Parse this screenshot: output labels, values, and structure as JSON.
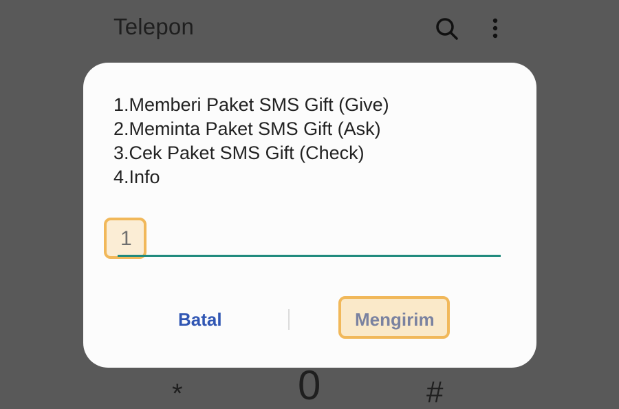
{
  "app": {
    "title": "Telepon",
    "icons": {
      "search": "search-icon",
      "more": "more-vert-icon"
    }
  },
  "keypad": {
    "keys": [
      "*",
      "0",
      "#"
    ]
  },
  "dialog": {
    "lines": [
      "1.Memberi Paket SMS Gift (Give)",
      "2.Meminta Paket SMS Gift (Ask)",
      "3.Cek Paket SMS Gift (Check)",
      "4.Info"
    ],
    "reply_value": "1",
    "cancel_label": "Batal",
    "send_label": "Mengirim"
  },
  "colors": {
    "backdrop": "#595959",
    "dialog_bg": "#fcfcfc",
    "accent_underline": "#1f8a7d",
    "cancel_text": "#3056b3",
    "send_text": "#7a82a0",
    "highlight": "#f1b85a"
  }
}
